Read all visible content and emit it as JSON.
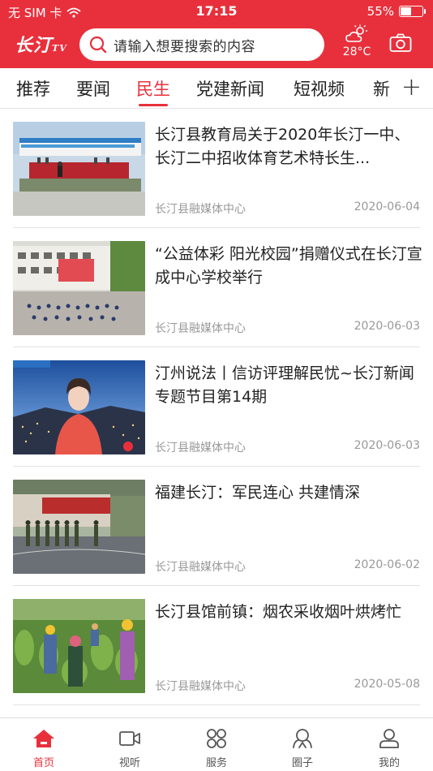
{
  "status_bar": {
    "carrier": "无 SIM 卡",
    "time": "17:15",
    "battery_text": "55%",
    "battery_level": 0.55
  },
  "header": {
    "logo_text": "长汀",
    "logo_sub": "TV",
    "search_placeholder": "请输入想要搜索的内容",
    "weather_icon": "partly-cloudy-icon",
    "temperature": "28°C",
    "camera_icon": "camera-icon"
  },
  "tabs": [
    {
      "label": "推荐",
      "active": false
    },
    {
      "label": "要闻",
      "active": false
    },
    {
      "label": "民生",
      "active": true
    },
    {
      "label": "党建新闻",
      "active": false
    },
    {
      "label": "短视频",
      "active": false
    },
    {
      "label": "新",
      "active": false
    }
  ],
  "tabs_add_label": "+",
  "news": [
    {
      "title": "长汀县教育局关于2020年长汀一中、长汀二中招收体育艺术特长生...",
      "source": "长汀县融媒体中心",
      "date": "2020-06-04",
      "thumb": "school-sports-meet-stage"
    },
    {
      "title": "“公益体彩 阳光校园”捐赠仪式在长汀宣成中心学校举行",
      "source": "长汀县融媒体中心",
      "date": "2020-06-03",
      "thumb": "school-courtyard-ceremony"
    },
    {
      "title": "汀州说法丨信访评理解民忧~长汀新闻专题节目第14期",
      "source": "长汀县融媒体中心",
      "date": "2020-06-03",
      "thumb": "news-anchor-city-night"
    },
    {
      "title": "福建长汀：军民连心 共建情深",
      "source": "长汀县融媒体中心",
      "date": "2020-06-02",
      "thumb": "soldiers-saluting-wall"
    },
    {
      "title": "长汀县馆前镇：烟农采收烟叶烘烤忙",
      "source": "长汀县融媒体中心",
      "date": "2020-05-08",
      "thumb": "tobacco-field-farmers"
    }
  ],
  "tabbar": [
    {
      "label": "首页",
      "icon": "home-icon",
      "active": true
    },
    {
      "label": "视听",
      "icon": "video-icon",
      "active": false
    },
    {
      "label": "服务",
      "icon": "services-grid-icon",
      "active": false
    },
    {
      "label": "圈子",
      "icon": "community-icon",
      "active": false
    },
    {
      "label": "我的",
      "icon": "profile-icon",
      "active": false
    }
  ],
  "colors": {
    "brand": "#e8303c",
    "text": "#222222",
    "meta": "#999999"
  }
}
